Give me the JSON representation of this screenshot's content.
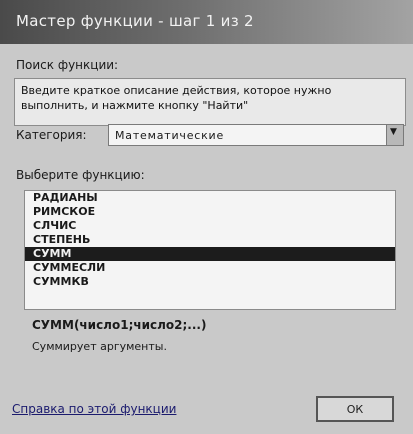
{
  "window": {
    "title": "Мастер функции - шаг 1 из 2"
  },
  "search": {
    "label": "Поиск функции:",
    "value": "Введите краткое описание действия, которое нужно выполнить, и нажмите кнопку \"Найти\""
  },
  "category": {
    "label": "Категория:",
    "value": "Математические"
  },
  "functions": {
    "label": "Выберите функцию:",
    "items": [
      "РАДИАНЫ",
      "РИМСКОЕ",
      "СЛЧИС",
      "СТЕПЕНЬ",
      "СУММ",
      "СУММЕСЛИ",
      "СУММКВ"
    ],
    "selected_index": 4
  },
  "selected_function": {
    "signature": "СУММ(число1;число2;...)",
    "description": "Суммирует аргументы."
  },
  "footer": {
    "help_link": "Справка по этой функции",
    "ok_label": "ОК"
  }
}
